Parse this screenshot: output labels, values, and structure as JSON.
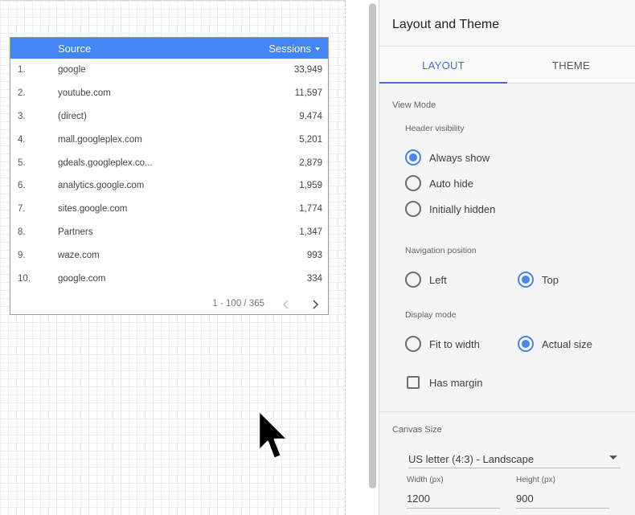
{
  "table": {
    "header": {
      "source": "Source",
      "sessions": "Sessions"
    },
    "rows": [
      {
        "index": "1.",
        "source": "google",
        "sessions": "33,949"
      },
      {
        "index": "2.",
        "source": "youtube.com",
        "sessions": "11,597"
      },
      {
        "index": "3.",
        "source": "(direct)",
        "sessions": "9,474"
      },
      {
        "index": "4.",
        "source": "mall.googleplex.com",
        "sessions": "5,201"
      },
      {
        "index": "5.",
        "source": "gdeals.googleplex.co...",
        "sessions": "2,879"
      },
      {
        "index": "6.",
        "source": "analytics.google.com",
        "sessions": "1,959"
      },
      {
        "index": "7.",
        "source": "sites.google.com",
        "sessions": "1,774"
      },
      {
        "index": "8.",
        "source": "Partners",
        "sessions": "1,347"
      },
      {
        "index": "9.",
        "source": "waze.com",
        "sessions": "993"
      },
      {
        "index": "10.",
        "source": "google.com",
        "sessions": "334"
      }
    ],
    "pager": {
      "text": "1 - 100 / 365"
    }
  },
  "panel": {
    "title": "Layout and Theme",
    "tabs": {
      "layout": "LAYOUT",
      "theme": "THEME"
    },
    "view_mode": {
      "label": "View Mode",
      "header_visibility": {
        "label": "Header visibility",
        "options": [
          "Always show",
          "Auto hide",
          "Initially hidden"
        ],
        "selected": "Always show"
      },
      "navigation_position": {
        "label": "Navigation position",
        "options": [
          "Left",
          "Top"
        ],
        "selected": "Top"
      },
      "display_mode": {
        "label": "Display mode",
        "options": [
          "Fit to width",
          "Actual size"
        ],
        "selected": "Actual size"
      },
      "has_margin": {
        "label": "Has margin",
        "checked": false
      }
    },
    "canvas_size": {
      "label": "Canvas Size",
      "selected": "US letter (4:3) - Landscape",
      "width_label": "Width (px)",
      "width_value": "1200",
      "height_label": "Height (px)",
      "height_value": "900"
    }
  },
  "colors": {
    "table_header": "#4285f4",
    "accent": "#4a86e8",
    "tab_active": "#3f6ed4"
  },
  "icons": {
    "sort": "sort-descending-icon",
    "pager_prev": "chevron-left-icon",
    "pager_next": "chevron-right-icon",
    "cursor": "mouse-pointer-icon",
    "dropdown": "caret-down-icon"
  }
}
